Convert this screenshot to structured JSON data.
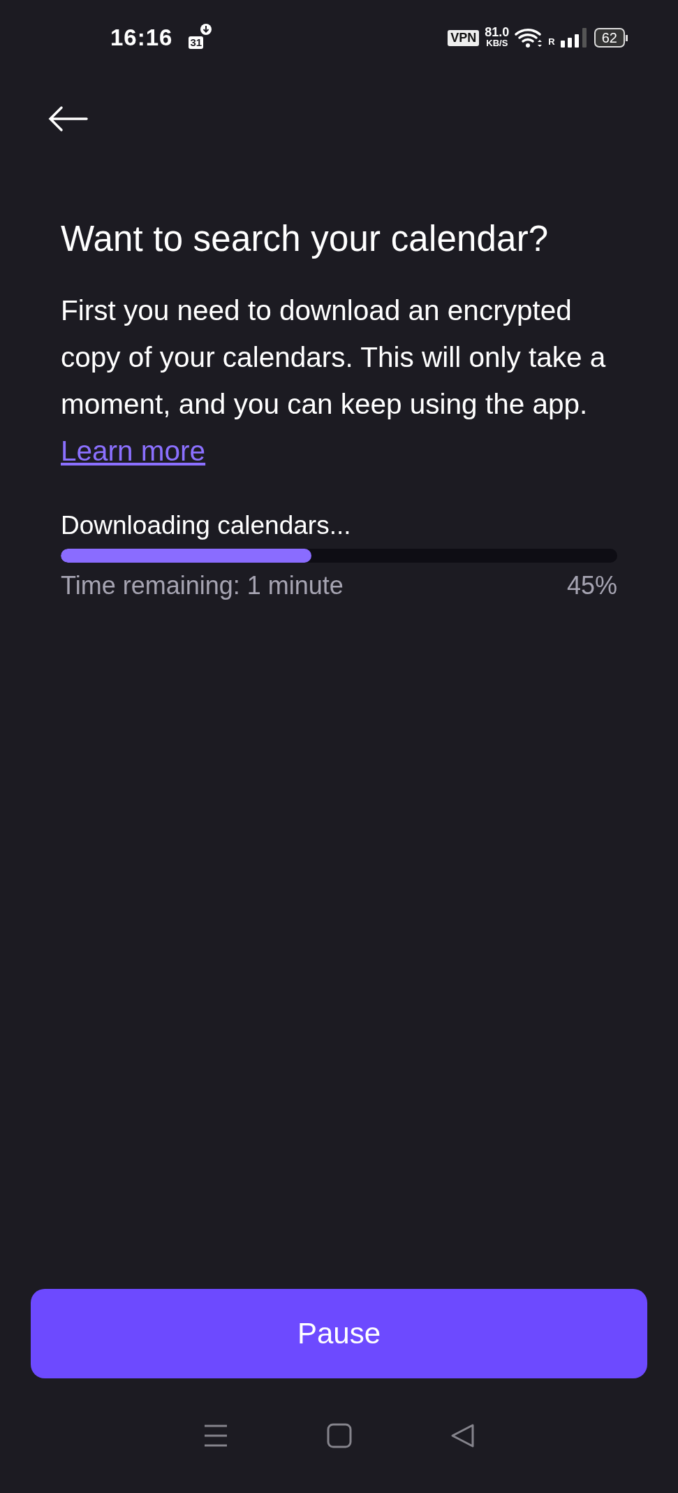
{
  "status_bar": {
    "time": "16:16",
    "notification_icon_text": "31",
    "vpn": "VPN",
    "speed_value": "81.0",
    "speed_unit": "KB/S",
    "roaming": "R",
    "battery": "62"
  },
  "title": "Want to search your calendar?",
  "body": "First you need to download an encrypted copy of your calendars. This will only take a moment, and you can keep using the app.",
  "link": "Learn more",
  "progress": {
    "label": "Downloading calendars...",
    "level": 0.45,
    "remaining": "Time remaining: 1 minute",
    "percent": "45%"
  },
  "button": "Pause"
}
